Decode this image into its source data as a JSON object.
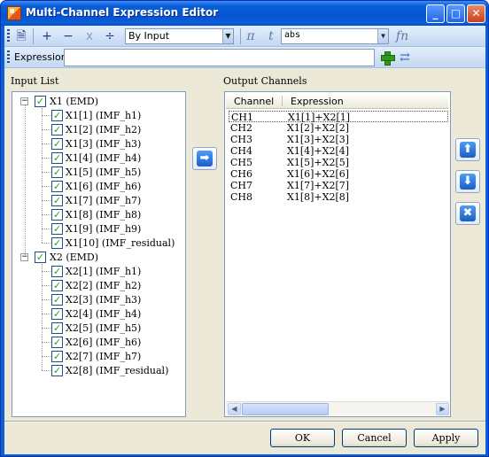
{
  "window": {
    "title": "Multi-Channel Expression Editor",
    "minimize": "_",
    "maximize": "□",
    "close": "✕"
  },
  "toolbar": {
    "plus": "+",
    "minus": "−",
    "times": "x",
    "divide": "÷",
    "mode_select": "By Input",
    "pi": "π",
    "t": "t",
    "function_select": "abs",
    "fn": "fn",
    "icons": [
      "notes-icon",
      "add-op-icon",
      "subtract-op-icon",
      "multiply-op-icon",
      "divide-op-icon",
      "pi-icon",
      "time-icon",
      "function-icon"
    ]
  },
  "expression": {
    "label": "Expression",
    "value": ""
  },
  "input_list": {
    "label": "Input List",
    "groups": [
      {
        "name": "X1 (EMD)",
        "expander": "−",
        "checked": true,
        "items": [
          "X1[1] (IMF_h1)",
          "X1[2] (IMF_h2)",
          "X1[3] (IMF_h3)",
          "X1[4] (IMF_h4)",
          "X1[5] (IMF_h5)",
          "X1[6] (IMF_h6)",
          "X1[7] (IMF_h7)",
          "X1[8] (IMF_h8)",
          "X1[9] (IMF_h9)",
          "X1[10] (IMF_residual)"
        ]
      },
      {
        "name": "X2 (EMD)",
        "expander": "−",
        "checked": true,
        "items": [
          "X2[1] (IMF_h1)",
          "X2[2] (IMF_h2)",
          "X2[3] (IMF_h3)",
          "X2[4] (IMF_h4)",
          "X2[5] (IMF_h5)",
          "X2[6] (IMF_h6)",
          "X2[7] (IMF_h7)",
          "X2[8] (IMF_residual)"
        ]
      }
    ],
    "check_mark": "✓"
  },
  "transfer_arrow": "➡",
  "output_channels": {
    "label": "Output Channels",
    "columns": [
      "Channel",
      "Expression"
    ],
    "rows": [
      [
        "CH1",
        "X1[1]+X2[1]"
      ],
      [
        "CH2",
        "X1[2]+X2[2]"
      ],
      [
        "CH3",
        "X1[3]+X2[3]"
      ],
      [
        "CH4",
        "X1[4]+X2[4]"
      ],
      [
        "CH5",
        "X1[5]+X2[5]"
      ],
      [
        "CH6",
        "X1[6]+X2[6]"
      ],
      [
        "CH7",
        "X1[7]+X2[7]"
      ],
      [
        "CH8",
        "X1[8]+X2[8]"
      ]
    ],
    "selected_row": 0,
    "scroll_left": "◀",
    "scroll_right": "▶"
  },
  "side_buttons": {
    "up": "⬆",
    "down": "⬇",
    "delete": "✖"
  },
  "buttons": {
    "ok": "OK",
    "cancel": "Cancel",
    "apply": "Apply"
  }
}
